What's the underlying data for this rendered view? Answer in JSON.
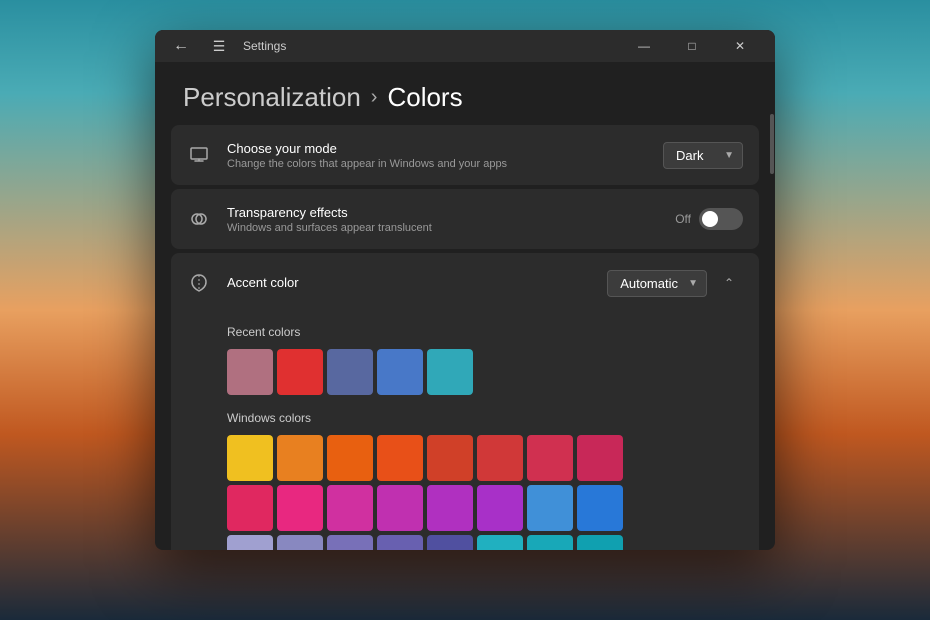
{
  "window": {
    "title": "Settings",
    "titlebar_bg": "#2c2c2c"
  },
  "titlebar": {
    "title": "Settings",
    "minimize": "—",
    "maximize": "□",
    "close": "✕"
  },
  "breadcrumb": {
    "parent": "Personalization",
    "separator": "›",
    "current": "Colors"
  },
  "settings": {
    "mode": {
      "title": "Choose your mode",
      "description": "Change the colors that appear in Windows and your apps",
      "value": "Dark"
    },
    "transparency": {
      "title": "Transparency effects",
      "description": "Windows and surfaces appear translucent",
      "value": "Off",
      "enabled": false
    },
    "accent": {
      "title": "Accent color",
      "value": "Automatic"
    }
  },
  "recent_colors_label": "Recent colors",
  "recent_colors": [
    "#b07080",
    "#e03030",
    "#5868a0",
    "#4878c8",
    "#30a8b8"
  ],
  "windows_colors_label": "Windows colors",
  "windows_colors_row1": [
    "#f0c020",
    "#e88020",
    "#e86010",
    "#e85018",
    "#d04028",
    "#d03838",
    "#d03050",
    "#c82858"
  ],
  "windows_colors_row2": [
    "#e02860",
    "#e82880",
    "#d030a0",
    "#c030b0",
    "#b030c0",
    "#a830c8",
    "#4090d8",
    "#2878d8"
  ],
  "windows_colors_row3": [
    "#a0a0d0",
    "#8888c0",
    "#7870b8",
    "#6860b0",
    "#5050a0",
    "#20b0c0",
    "#18a8b8",
    "#10a0b0"
  ]
}
